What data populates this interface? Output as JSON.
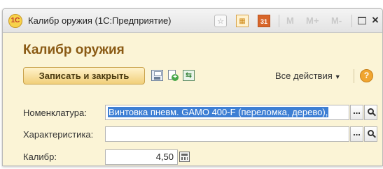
{
  "window": {
    "title": "Калибр оружия  (1С:Предприятие)",
    "logo_text": "1С",
    "toolbar_icons": [
      "star-icon",
      "calculator-icon",
      "calendar-icon"
    ],
    "calendar_label": "31",
    "memory_buttons": [
      "M",
      "M+",
      "M-"
    ]
  },
  "form": {
    "title": "Калибр оружия"
  },
  "command_bar": {
    "save_close_label": "Записать и закрыть",
    "icons": [
      "save-icon",
      "copy-icon",
      "post-icon"
    ],
    "all_actions_label": "Все действия",
    "help_label": "?"
  },
  "fields": {
    "nomenclature": {
      "label": "Номенклатура:",
      "value": "Винтовка пневм. GAMO 400-F (переломка, дерево),"
    },
    "characteristic": {
      "label": "Характеристика:",
      "value": ""
    },
    "caliber": {
      "label": "Калибр:",
      "value": "4,50"
    }
  },
  "buttons": {
    "dots_label": "...",
    "close_label": "×"
  },
  "colors": {
    "form_background": "#fbf4d6",
    "title_color": "#8a5a14",
    "selection": "#3e7fd4",
    "accent_button": "#f1cf7a"
  }
}
